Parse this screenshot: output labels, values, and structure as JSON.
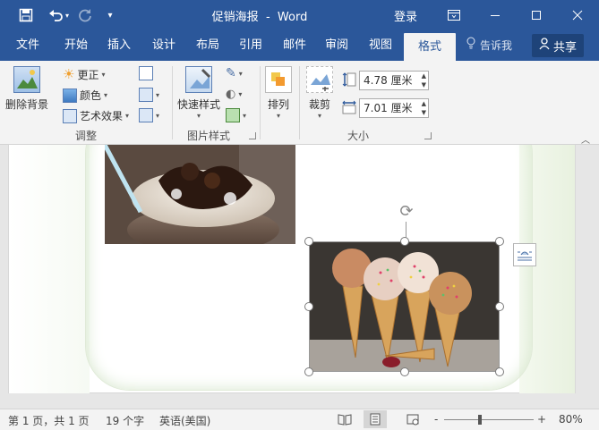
{
  "titlebar": {
    "save_icon": "save-icon",
    "undo_icon": "undo-icon",
    "redo_icon": "redo-icon",
    "customize_icon": "customize-qat-icon",
    "document_name": "促销海报",
    "separator": "-",
    "app_name": "Word",
    "title_full": "促销海报  -  Word",
    "login": "登录",
    "ribbon_display_icon": "ribbon-display-icon",
    "minimize_icon": "minimize-icon",
    "maximize_icon": "maximize-icon",
    "close_icon": "close-icon"
  },
  "tabs": [
    {
      "label": "文件",
      "active": false
    },
    {
      "label": "开始",
      "active": false
    },
    {
      "label": "插入",
      "active": false
    },
    {
      "label": "设计",
      "active": false
    },
    {
      "label": "布局",
      "active": false
    },
    {
      "label": "引用",
      "active": false
    },
    {
      "label": "邮件",
      "active": false
    },
    {
      "label": "审阅",
      "active": false
    },
    {
      "label": "视图",
      "active": false
    },
    {
      "label": "格式",
      "active": true
    }
  ],
  "tellme": {
    "label": "告诉我",
    "icon": "lightbulb-icon"
  },
  "share": {
    "label": "共享",
    "icon": "person-icon"
  },
  "ribbon": {
    "adjust": {
      "remove_bg": "删除背景",
      "corrections": "更正",
      "color": "颜色",
      "artistic": "艺术效果",
      "group_label": "调整"
    },
    "styles": {
      "quick_styles": "快速样式",
      "group_label": "图片样式"
    },
    "arrange": {
      "label": "排列"
    },
    "size": {
      "crop": "裁剪",
      "height_value": "4.78 厘米",
      "width_value": "7.01 厘米",
      "group_label": "大小"
    }
  },
  "statusbar": {
    "page": "第 1 页，共 1 页",
    "words": "19 个字",
    "language": "英语(美国)",
    "zoom_minus": "-",
    "zoom_plus": "+",
    "zoom": "80%"
  },
  "colors": {
    "accent": "#2b579a",
    "ribbon_bg": "#f3f3f3",
    "share_bg": "#1e4379"
  }
}
